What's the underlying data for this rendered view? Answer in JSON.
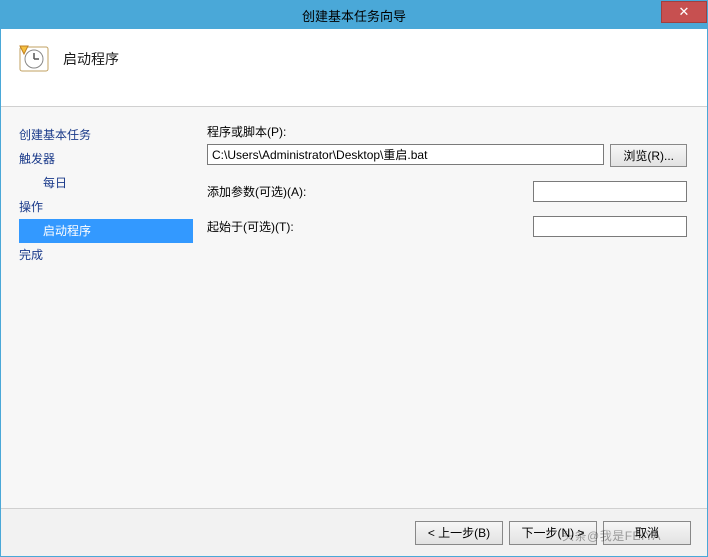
{
  "window": {
    "title": "创建基本任务向导",
    "close_glyph": "✕"
  },
  "header": {
    "title": "启动程序"
  },
  "sidebar": {
    "steps": {
      "create": "创建基本任务",
      "trigger": "触发器",
      "trigger_sub": "每日",
      "action": "操作",
      "action_sub": "启动程序",
      "finish": "完成"
    }
  },
  "form": {
    "script_label": "程序或脚本(P):",
    "script_value": "C:\\Users\\Administrator\\Desktop\\重启.bat",
    "browse_label": "浏览(R)...",
    "args_label": "添加参数(可选)(A):",
    "args_value": "",
    "startin_label": "起始于(可选)(T):",
    "startin_value": ""
  },
  "footer": {
    "back": "< 上一步(B)",
    "next": "下一步(N) >",
    "cancel": "取消"
  },
  "watermark": "头条@我是FEIYA"
}
